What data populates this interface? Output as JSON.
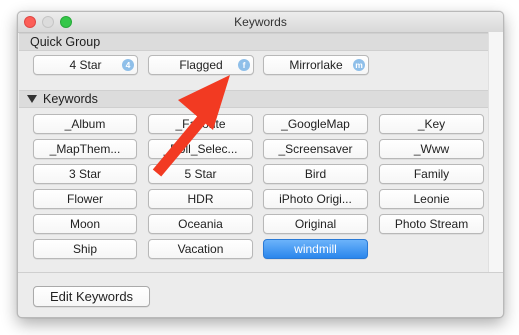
{
  "window": {
    "title": "Keywords"
  },
  "quick_group": {
    "header": "Quick Group",
    "items": [
      {
        "label": "4 Star",
        "shortcut": "4"
      },
      {
        "label": "Flagged",
        "shortcut": "f"
      },
      {
        "label": "Mirrorlake",
        "shortcut": "m"
      }
    ]
  },
  "keywords": {
    "header": "Keywords",
    "items": [
      {
        "label": "_Album"
      },
      {
        "label": "_Favorite"
      },
      {
        "label": "_GoogleMap"
      },
      {
        "label": "_Key"
      },
      {
        "label": "_MapThem..."
      },
      {
        "label": "_Roll_Selec..."
      },
      {
        "label": "_Screensaver"
      },
      {
        "label": "_Www"
      },
      {
        "label": "3 Star"
      },
      {
        "label": "5 Star"
      },
      {
        "label": "Bird"
      },
      {
        "label": "Family"
      },
      {
        "label": "Flower"
      },
      {
        "label": "HDR"
      },
      {
        "label": "iPhoto Origi..."
      },
      {
        "label": "Leonie"
      },
      {
        "label": "Moon"
      },
      {
        "label": "Oceania"
      },
      {
        "label": "Original"
      },
      {
        "label": "Photo Stream"
      },
      {
        "label": "Ship"
      },
      {
        "label": "Vacation"
      },
      {
        "label": "windmill",
        "selected": true
      }
    ]
  },
  "footer": {
    "edit_button": "Edit Keywords"
  },
  "colors": {
    "selected_button": "#2a86ec",
    "annotation_arrow": "#f23a22",
    "shortcut_badge": "#8fbfe9"
  }
}
